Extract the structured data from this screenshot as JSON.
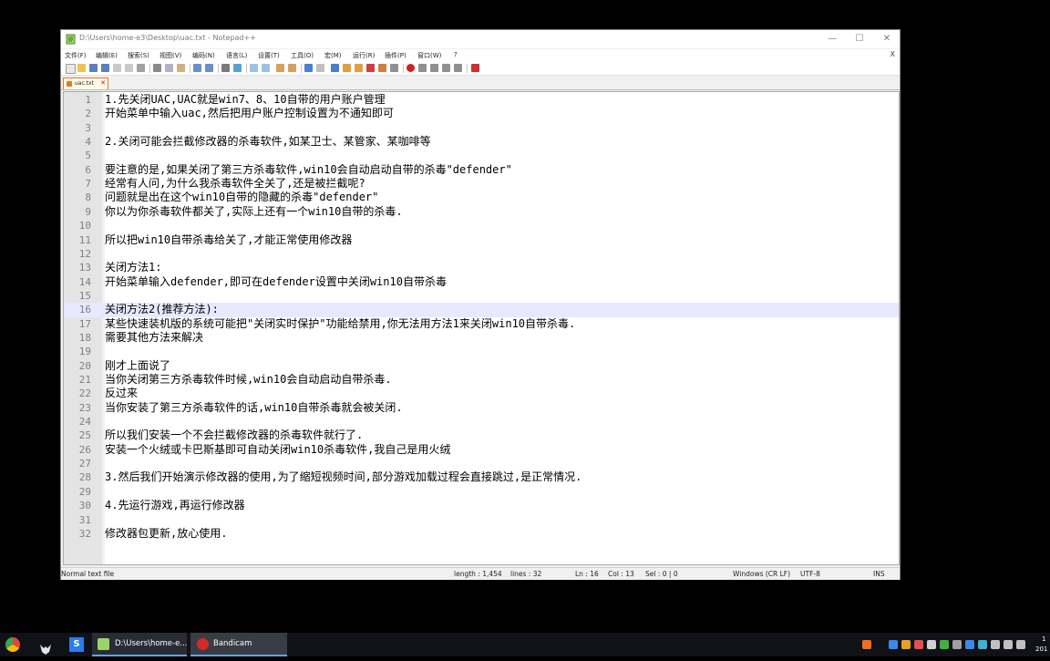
{
  "window": {
    "title": "D:\\Users\\home-e3\\Desktop\\uac.txt - Notepad++",
    "minimize": "—",
    "maximize": "☐",
    "close": "✕"
  },
  "menu": [
    "文件(F)",
    "编辑(E)",
    "搜索(S)",
    "视图(V)",
    "编码(N)",
    "语言(L)",
    "设置(T)",
    "工具(O)",
    "宏(M)",
    "运行(R)",
    "插件(P)",
    "窗口(W)",
    "?"
  ],
  "menu_close": "X",
  "tab": {
    "label": "uac.txt",
    "close": "✕"
  },
  "lines": [
    {
      "n": "1",
      "t": "1.先关闭UAC,UAC就是win7、8、10自带的用户账户管理"
    },
    {
      "n": "2",
      "t": "开始菜单中输入uac,然后把用户账户控制设置为不通知即可"
    },
    {
      "n": "3",
      "t": ""
    },
    {
      "n": "4",
      "t": "2.关闭可能会拦截修改器的杀毒软件,如某卫士、某管家、某咖啡等"
    },
    {
      "n": "5",
      "t": ""
    },
    {
      "n": "6",
      "t": "要注意的是,如果关闭了第三方杀毒软件,win10会自动启动自带的杀毒\"defender\""
    },
    {
      "n": "7",
      "t": "经常有人问,为什么我杀毒软件全关了,还是被拦截呢?"
    },
    {
      "n": "8",
      "t": "问题就是出在这个win10自带的隐藏的杀毒\"defender\""
    },
    {
      "n": "9",
      "t": "你以为你杀毒软件都关了,实际上还有一个win10自带的杀毒."
    },
    {
      "n": "10",
      "t": ""
    },
    {
      "n": "11",
      "t": "所以把win10自带杀毒给关了,才能正常使用修改器"
    },
    {
      "n": "12",
      "t": ""
    },
    {
      "n": "13",
      "t": "关闭方法1:"
    },
    {
      "n": "14",
      "t": "开始菜单输入defender,即可在defender设置中关闭win10自带杀毒"
    },
    {
      "n": "15",
      "t": ""
    },
    {
      "n": "16",
      "t": "关闭方法2(推荐方法):"
    },
    {
      "n": "17",
      "t": "某些快速装机版的系统可能把\"关闭实时保护\"功能给禁用,你无法用方法1来关闭win10自带杀毒."
    },
    {
      "n": "18",
      "t": "需要其他方法来解决"
    },
    {
      "n": "19",
      "t": ""
    },
    {
      "n": "20",
      "t": "刚才上面说了"
    },
    {
      "n": "21",
      "t": "当你关闭第三方杀毒软件时候,win10会自动启动自带杀毒."
    },
    {
      "n": "22",
      "t": "反过来"
    },
    {
      "n": "23",
      "t": "当你安装了第三方杀毒软件的话,win10自带杀毒就会被关闭."
    },
    {
      "n": "24",
      "t": ""
    },
    {
      "n": "25",
      "t": "所以我们安装一个不会拦截修改器的杀毒软件就行了."
    },
    {
      "n": "26",
      "t": "安装一个火绒或卡巴斯基即可自动关闭win10杀毒软件,我自己是用火绒"
    },
    {
      "n": "27",
      "t": ""
    },
    {
      "n": "28",
      "t": "3.然后我们开始演示修改器的使用,为了缩短视频时间,部分游戏加载过程会直接跳过,是正常情况."
    },
    {
      "n": "29",
      "t": ""
    },
    {
      "n": "30",
      "t": "4.先运行游戏,再运行修改器"
    },
    {
      "n": "31",
      "t": ""
    },
    {
      "n": "32",
      "t": "修改器包更新,放心使用."
    }
  ],
  "current_line": 16,
  "status": {
    "type": "Normal text file",
    "length": "length : 1,454",
    "lines": "lines : 32",
    "ln": "Ln : 16",
    "col": "Col : 13",
    "sel": "Sel : 0 | 0",
    "eol": "Windows (CR LF)",
    "encoding": "UTF-8",
    "mode": "INS"
  },
  "taskbar": {
    "notepad_label": "D:\\Users\\home-e...",
    "bandicam_label": "Bandicam",
    "clock_top": "1",
    "clock_bottom": "201"
  },
  "colors": {
    "current_line": "#e8e8ff",
    "tab_accent": "#e07a2a",
    "gutter": "#e4e4e4"
  }
}
